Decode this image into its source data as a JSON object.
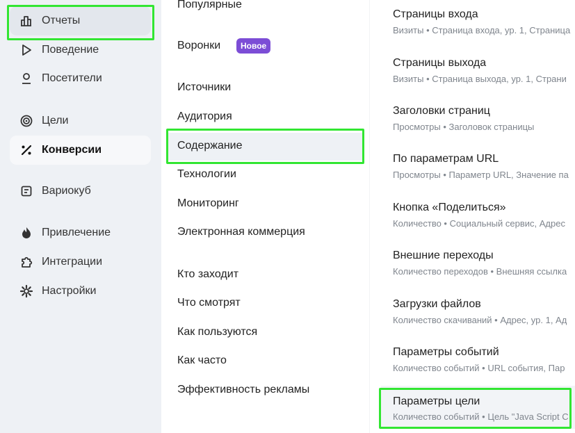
{
  "sidebar": {
    "items": [
      {
        "label": "Отчеты",
        "icon": "bar-chart-icon"
      },
      {
        "label": "Поведение",
        "icon": "play-icon"
      },
      {
        "label": "Посетители",
        "icon": "person-icon"
      },
      {
        "label": "Цели",
        "icon": "target-icon"
      },
      {
        "label": "Конверсии",
        "icon": "percent-icon"
      },
      {
        "label": "Вариокуб",
        "icon": "cube-table-icon"
      },
      {
        "label": "Привлечение",
        "icon": "flame-icon"
      },
      {
        "label": "Интеграции",
        "icon": "puzzle-icon"
      },
      {
        "label": "Настройки",
        "icon": "gear-icon"
      }
    ]
  },
  "submenu": {
    "items": [
      {
        "label": "Популярные"
      },
      {
        "label": "Воронки",
        "badge": "Новое"
      },
      {
        "label": "Источники"
      },
      {
        "label": "Аудитория"
      },
      {
        "label": "Содержание"
      },
      {
        "label": "Технологии"
      },
      {
        "label": "Мониторинг"
      },
      {
        "label": "Электронная коммерция"
      },
      {
        "label": "Кто заходит"
      },
      {
        "label": "Что смотрят"
      },
      {
        "label": "Как пользуются"
      },
      {
        "label": "Как часто"
      },
      {
        "label": "Эффективность рекламы"
      }
    ]
  },
  "reports": {
    "items": [
      {
        "title": "Страницы входа",
        "sub": "Визиты • Страница входа, ур. 1, Страница"
      },
      {
        "title": "Страницы выхода",
        "sub": "Визиты • Страница выхода, ур. 1, Страни"
      },
      {
        "title": "Заголовки страниц",
        "sub": "Просмотры • Заголовок страницы"
      },
      {
        "title": "По параметрам URL",
        "sub": "Просмотры • Параметр URL, Значение па"
      },
      {
        "title": "Кнопка «Поделиться»",
        "sub": "Количество • Социальный сервис, Адрес"
      },
      {
        "title": "Внешние переходы",
        "sub": "Количество переходов • Внешняя ссылка"
      },
      {
        "title": "Загрузки файлов",
        "sub": "Количество скачиваний • Адрес, ур. 1, Ад"
      },
      {
        "title": "Параметры событий",
        "sub": "Количество событий • URL события, Пар"
      },
      {
        "title": "Параметры цели",
        "sub": "Количество событий • Цель \"Java Script С"
      }
    ]
  },
  "colors": {
    "highlight": "#32e632",
    "badge": "#7c4dd6",
    "sidebar_bg": "#eef1f5"
  }
}
